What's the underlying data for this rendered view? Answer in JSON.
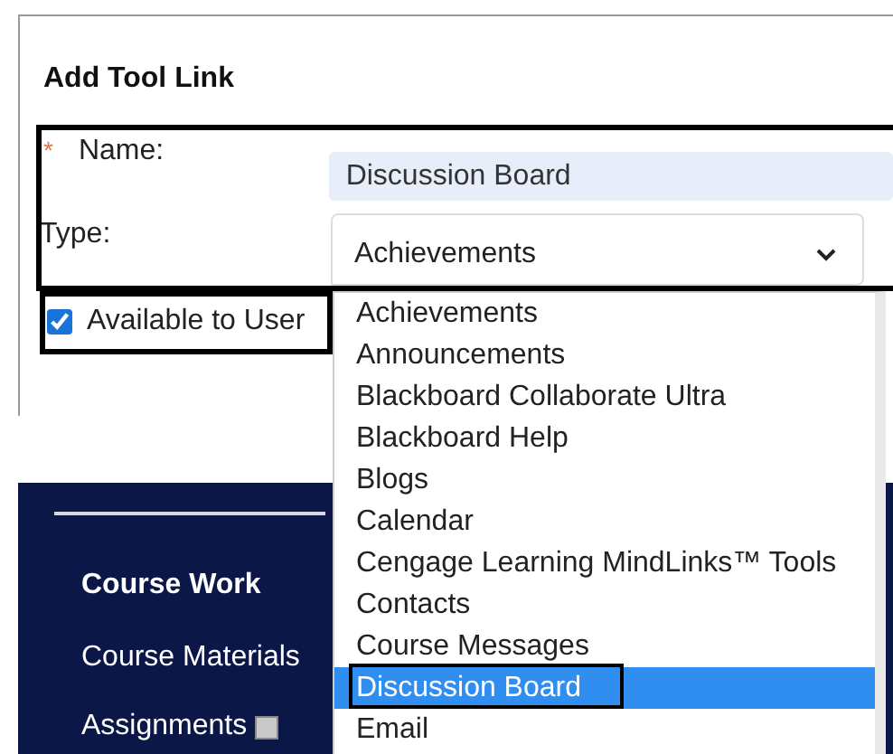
{
  "dialog": {
    "title": "Add Tool Link",
    "name_field": {
      "label": "Name:",
      "required_mark": "*",
      "value": "Discussion Board"
    },
    "type_field": {
      "label": "Type:",
      "value": "Achievements",
      "expanded": true
    },
    "available": {
      "label": "Available to User",
      "checked": true
    }
  },
  "type_options": [
    {
      "label": "Achievements",
      "selected": false
    },
    {
      "label": "Announcements",
      "selected": false
    },
    {
      "label": "Blackboard Collaborate Ultra",
      "selected": false
    },
    {
      "label": "Blackboard Help",
      "selected": false
    },
    {
      "label": "Blogs",
      "selected": false
    },
    {
      "label": "Calendar",
      "selected": false
    },
    {
      "label": "Cengage Learning MindLinks™ Tools",
      "selected": false
    },
    {
      "label": "Contacts",
      "selected": false
    },
    {
      "label": "Course Messages",
      "selected": false
    },
    {
      "label": "Discussion Board",
      "selected": true
    },
    {
      "label": "Email",
      "selected": false
    }
  ],
  "sidebar": {
    "items": [
      {
        "label": "Course Work",
        "kind": "heading"
      },
      {
        "label": "Course Materials",
        "kind": "link"
      },
      {
        "label": "Assignments",
        "kind": "link-icon"
      }
    ]
  }
}
